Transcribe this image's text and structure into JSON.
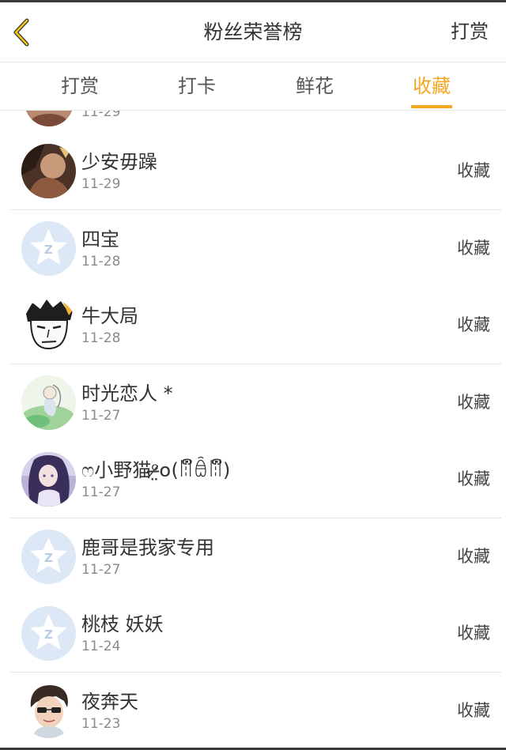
{
  "header": {
    "title": "粉丝荣誉榜",
    "action_label": "打赏",
    "back_icon": "chevron-left-icon"
  },
  "tabs": [
    {
      "label": "打赏",
      "active": false
    },
    {
      "label": "打卡",
      "active": false
    },
    {
      "label": "鲜花",
      "active": false
    },
    {
      "label": "收藏",
      "active": true
    }
  ],
  "colors": {
    "accent": "#f5a623",
    "text": "#333333",
    "subtext": "#8a8a8a",
    "divider": "#e4e4e4",
    "default_avatar": "#dce8f5"
  },
  "partial_item": {
    "date": "11-29"
  },
  "fans": [
    {
      "name": "少安毋躁",
      "date": "11-29",
      "action": "收藏",
      "avatar": "photo-avatar-brown"
    },
    {
      "name": "四宝",
      "date": "11-28",
      "action": "收藏",
      "avatar": "default-q-avatar"
    },
    {
      "name": "牛大局",
      "date": "11-28",
      "action": "收藏",
      "avatar": "cartoon-face-avatar"
    },
    {
      "name": "时光恋人 *",
      "date": "11-27",
      "action": "收藏",
      "avatar": "illustration-avatar-green"
    },
    {
      "name": "ෆ小野猫ᵒ̶̷̤໐(ꈨຶꎁꈨຶ)",
      "date": "11-27",
      "action": "收藏",
      "avatar": "anime-girl-avatar"
    },
    {
      "name": "鹿哥是我家专用",
      "date": "11-27",
      "action": "收藏",
      "avatar": "default-q-avatar"
    },
    {
      "name": "桃枝 妖妖",
      "date": "11-24",
      "action": "收藏",
      "avatar": "default-q-avatar"
    },
    {
      "name": "夜奔天",
      "date": "11-23",
      "action": "收藏",
      "avatar": "cartoon-boy-avatar"
    }
  ]
}
